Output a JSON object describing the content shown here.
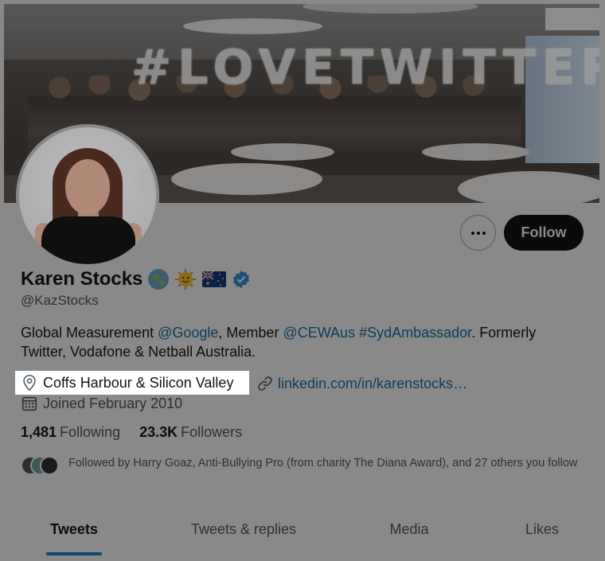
{
  "profile": {
    "name": "Karen Stocks",
    "handle": "@KazStocks",
    "badges": [
      "globe-asia-australia",
      "sun-with-face",
      "australia-flag",
      "verified"
    ],
    "bio": {
      "p1": "Global Measurement ",
      "mention1": "@Google",
      "p2": ", Member ",
      "mention2": "@CEWAus",
      "p3": " ",
      "hashtag": "#SydAmbassador",
      "p4": ". Formerly Twitter, Vodafone & Netball Australia."
    },
    "location": "Coffs Harbour & Silicon Valley",
    "website": "linkedin.com/in/karenstocks…",
    "joined": "Joined February 2010",
    "following_count": "1,481",
    "following_label": "Following",
    "followers_count": "23.3K",
    "followers_label": "Followers",
    "followed_by": "Followed by Harry Goaz, Anti-Bullying Pro (from charity The Diana Award), and 27 others you follow"
  },
  "actions": {
    "follow_label": "Follow",
    "more_icon": "ellipsis-icon"
  },
  "banner": {
    "balloon_text": "#LOVETWITTER"
  },
  "tabs": [
    {
      "label": "Tweets",
      "active": true
    },
    {
      "label": "Tweets & replies",
      "active": false
    },
    {
      "label": "Media",
      "active": false
    },
    {
      "label": "Likes",
      "active": false
    }
  ],
  "colors": {
    "overlay_bg": "#898989",
    "link": "#0b3c5a",
    "verified": "#1d4f73",
    "follow_button": "#0a0a0a",
    "tab_indicator": "#0b4a70"
  }
}
